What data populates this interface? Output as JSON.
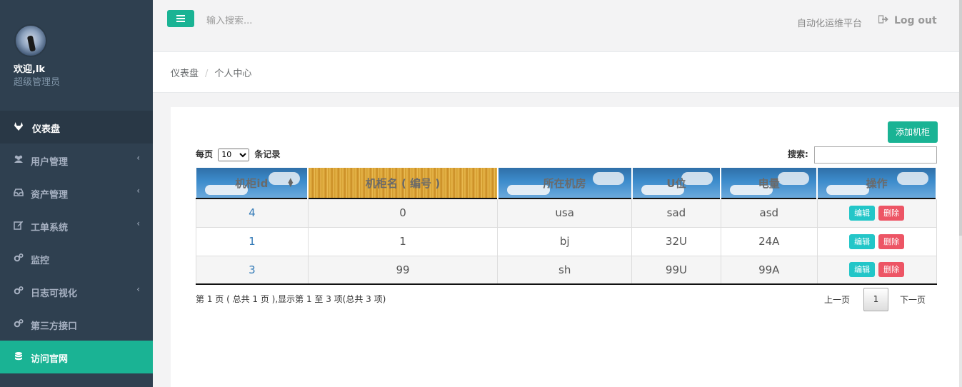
{
  "profile": {
    "welcome": "欢迎,lk",
    "role": "超级管理员"
  },
  "sidebar": {
    "items": [
      {
        "label": "仪表盘",
        "icon": "gitlab-fox-icon",
        "has_chevron": false
      },
      {
        "label": "用户管理",
        "icon": "users-icon",
        "has_chevron": true
      },
      {
        "label": "资产管理",
        "icon": "inbox-icon",
        "has_chevron": true
      },
      {
        "label": "工单系统",
        "icon": "edit-icon",
        "has_chevron": true
      },
      {
        "label": "监控",
        "icon": "gears-icon",
        "has_chevron": false
      },
      {
        "label": "日志可视化",
        "icon": "gears-icon",
        "has_chevron": true
      },
      {
        "label": "第三方接口",
        "icon": "gears-icon",
        "has_chevron": false
      },
      {
        "label": "访问官网",
        "icon": "database-icon",
        "has_chevron": false
      }
    ],
    "chevron": "‹"
  },
  "topbar": {
    "search_placeholder": "输入搜索...",
    "platform": "自动化运维平台",
    "logout": "Log out"
  },
  "breadcrumb": {
    "home": "仪表盘",
    "sep": "/",
    "current": "个人中心"
  },
  "toolbar": {
    "add_label": "添加机柜"
  },
  "table_controls": {
    "length_prefix": "每页",
    "length_value": "10",
    "length_suffix": "条记录",
    "search_label": "搜索:"
  },
  "table": {
    "headers": [
      "机柜id",
      "机柜名 ( 编号 )",
      "所在机房",
      "U位",
      "电量",
      "操作"
    ],
    "rows": [
      {
        "id": "4",
        "name": "0",
        "room": "usa",
        "u": "sad",
        "power": "asd"
      },
      {
        "id": "1",
        "name": "1",
        "room": "bj",
        "u": "32U",
        "power": "24A"
      },
      {
        "id": "3",
        "name": "99",
        "room": "sh",
        "u": "99U",
        "power": "99A"
      }
    ],
    "edit_label": "编辑",
    "delete_label": "删除"
  },
  "pagination": {
    "info": "第 1 页 ( 总共 1 页 ),显示第 1 至 3 项(总共 3 项)",
    "prev": "上一页",
    "page": "1",
    "next": "下一页"
  },
  "colors": {
    "sidebar": "#2f4050",
    "accent": "#1ab394",
    "edit": "#23c6c8",
    "delete": "#ed5565"
  }
}
